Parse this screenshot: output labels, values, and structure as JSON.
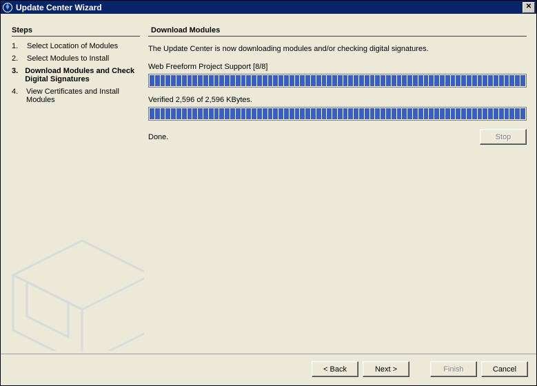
{
  "window": {
    "title": "Update Center Wizard"
  },
  "sidebar": {
    "heading": "Steps",
    "steps": [
      {
        "num": "1.",
        "label": "Select Location of Modules",
        "active": false
      },
      {
        "num": "2.",
        "label": "Select Modules to Install",
        "active": false
      },
      {
        "num": "3.",
        "label": "Download Modules and Check Digital Signatures",
        "active": true
      },
      {
        "num": "4.",
        "label": "View Certificates and Install Modules",
        "active": false
      }
    ]
  },
  "main": {
    "heading": "Download Modules",
    "description": "The Update Center is now downloading modules and/or checking digital signatures.",
    "progress1_label": "Web Freeform Project Support [8/8]",
    "progress1_percent": 100,
    "progress2_label": "Verified 2,596 of 2,596 KBytes.",
    "progress2_percent": 100,
    "status_text": "Done.",
    "stop_label": "Stop"
  },
  "footer": {
    "back": "< Back",
    "next": "Next >",
    "finish": "Finish",
    "cancel": "Cancel"
  }
}
